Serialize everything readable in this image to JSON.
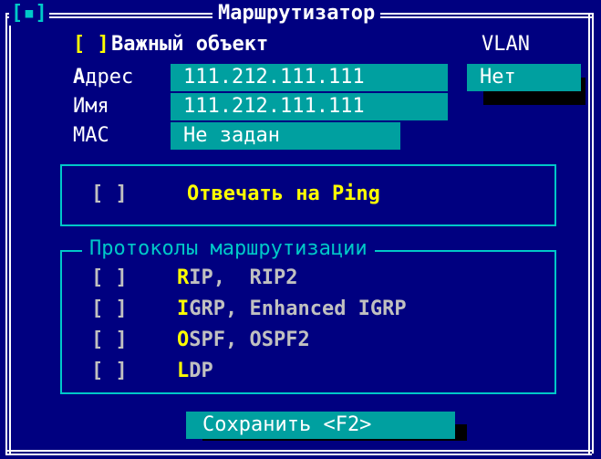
{
  "window": {
    "title": "Маршрутизатор",
    "close_glyph": "[▪]"
  },
  "top": {
    "important_checkbox": "[ ]",
    "important_label": "Важный объект",
    "vlan_label": "VLAN",
    "vlan_value": "Нет",
    "address_label": "Адрес",
    "address_value": "111.212.111.111",
    "name_label": "Имя",
    "name_value": "111.212.111.111",
    "mac_label": "MAC",
    "mac_value": "Не задан"
  },
  "ping": {
    "checkbox": "[ ]",
    "label": "Отвечать на Ping"
  },
  "protocols": {
    "group_title": "Протоколы маршрутизации",
    "items": [
      {
        "checkbox": "[ ]",
        "hotkey": "R",
        "rest": "IP,  RIP2"
      },
      {
        "checkbox": "[ ]",
        "hotkey": "I",
        "rest": "GRP, Enhanced IGRP"
      },
      {
        "checkbox": "[ ]",
        "hotkey": "O",
        "rest": "SPF, OSPF2"
      },
      {
        "checkbox": "[ ]",
        "hotkey": "L",
        "rest": "DP"
      }
    ]
  },
  "save_button": "Сохранить <F2>",
  "colors": {
    "background": "#000080",
    "field": "#00a0a0",
    "frame": "#00c8c8",
    "hotkey": "#ffff00"
  }
}
